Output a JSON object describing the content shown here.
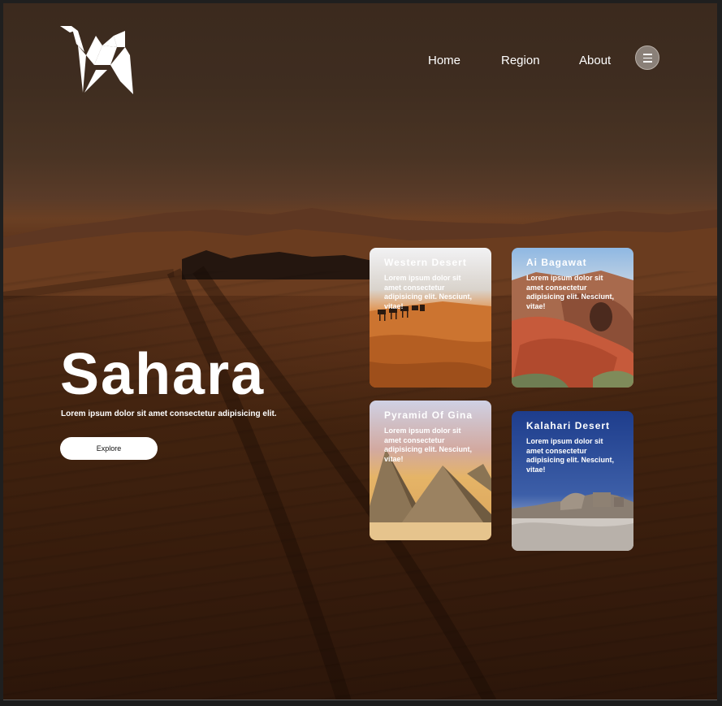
{
  "nav": {
    "links": [
      "Home",
      "Region",
      "About"
    ],
    "menu_icon": "hamburger-icon"
  },
  "logo": {
    "icon": "camel-origami-logo"
  },
  "hero": {
    "title": "Sahara",
    "subtitle": "Lorem ipsum dolor sit amet consectetur adipisicing elit.",
    "button": "Explore"
  },
  "cards": [
    {
      "title": "Western Desert",
      "text": "Lorem ipsum dolor sit amet consectetur adipisicing elit. Nesciunt, vitae!"
    },
    {
      "title": "Ai Bagawat",
      "text": "Lorem ipsum dolor sit amet consectetur adipisicing elit. Nesciunt, vitae!"
    },
    {
      "title": "Pyramid Of Gina",
      "text": "Lorem ipsum dolor sit amet consectetur adipisicing elit. Nesciunt, vitae!"
    },
    {
      "title": "Kalahari Desert",
      "text": "Lorem ipsum dolor sit amet consectetur adipisicing elit. Nesciunt, vitae!"
    }
  ],
  "colors": {
    "text": "#ffffff",
    "button_bg": "#ffffff",
    "sand": "#5b321a"
  }
}
